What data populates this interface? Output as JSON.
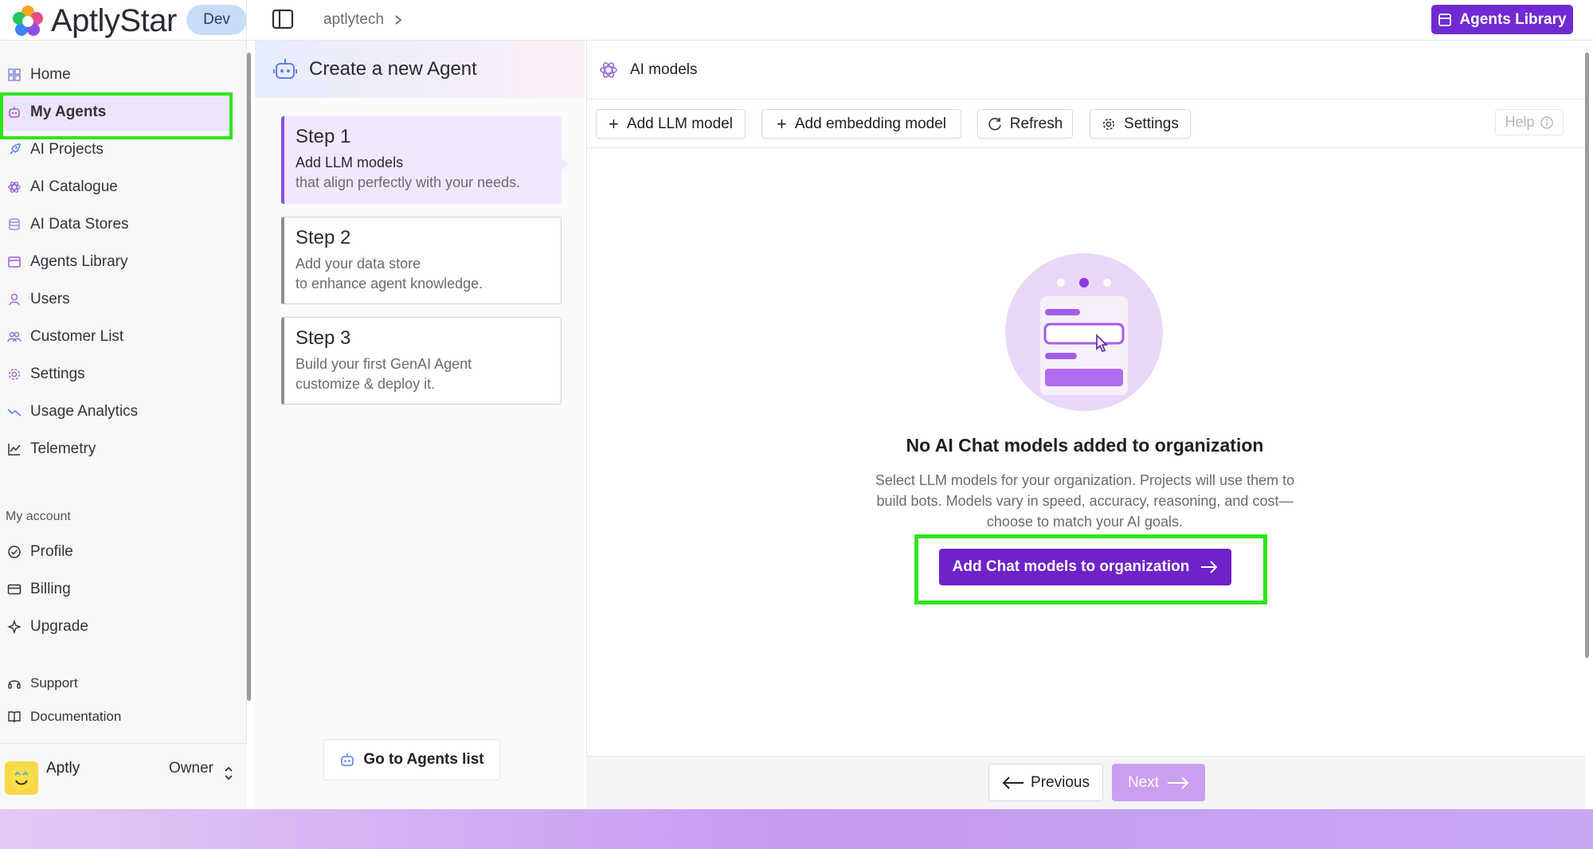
{
  "app": {
    "logo_text": "AptlyStar",
    "env_badge": "Dev",
    "breadcrumb": "aptlytech",
    "agents_library_button": "Agents Library"
  },
  "sidebar": {
    "items": [
      {
        "label": "Home",
        "icon": "home-icon"
      },
      {
        "label": "My Agents",
        "icon": "robot-icon",
        "active": true
      },
      {
        "label": "AI Projects",
        "icon": "rocket-icon"
      },
      {
        "label": "AI Catalogue",
        "icon": "atom-icon"
      },
      {
        "label": "AI Data Stores",
        "icon": "database-icon"
      },
      {
        "label": "Agents Library",
        "icon": "library-icon"
      },
      {
        "label": "Users",
        "icon": "user-icon"
      },
      {
        "label": "Customer List",
        "icon": "customers-icon"
      },
      {
        "label": "Settings",
        "icon": "gear-icon"
      },
      {
        "label": "Usage Analytics",
        "icon": "trend-icon"
      },
      {
        "label": "Telemetry",
        "icon": "chart-icon"
      }
    ],
    "account_label": "My account",
    "account_items": [
      {
        "label": "Profile",
        "icon": "profile-icon"
      },
      {
        "label": "Billing",
        "icon": "billing-icon"
      },
      {
        "label": "Upgrade",
        "icon": "sparkle-icon"
      }
    ],
    "support_items": [
      {
        "label": "Support",
        "icon": "headset-icon"
      },
      {
        "label": "Documentation",
        "icon": "book-icon"
      }
    ],
    "user": {
      "name": "Aptly",
      "role": "Owner"
    }
  },
  "steps_panel": {
    "title": "Create a new Agent",
    "steps": [
      {
        "title": "Step 1",
        "desc": "Add LLM models",
        "sub": "that align perfectly with your needs."
      },
      {
        "title": "Step 2",
        "desc": "Add your data store",
        "sub": "to enhance agent knowledge."
      },
      {
        "title": "Step 3",
        "desc": "Build your first GenAI Agent",
        "sub": "customize & deploy it."
      }
    ],
    "goto_button": "Go to Agents list"
  },
  "main": {
    "title": "AI models",
    "toolbar": {
      "add_llm": "Add LLM model",
      "add_embedding": "Add embedding model",
      "refresh": "Refresh",
      "settings": "Settings",
      "help": "Help"
    },
    "empty_title": "No AI Chat models added to organization",
    "empty_desc": "Select LLM models for your organization. Projects will use them to build bots. Models vary in speed, accuracy, reasoning, and cost—choose to match your AI goals.",
    "cta_button": "Add Chat models to organization",
    "footer": {
      "previous": "Previous",
      "next": "Next"
    }
  },
  "colors": {
    "brand": "#6f2bd1",
    "highlight": "#2ee51a",
    "active_bg": "#ece4fb"
  }
}
